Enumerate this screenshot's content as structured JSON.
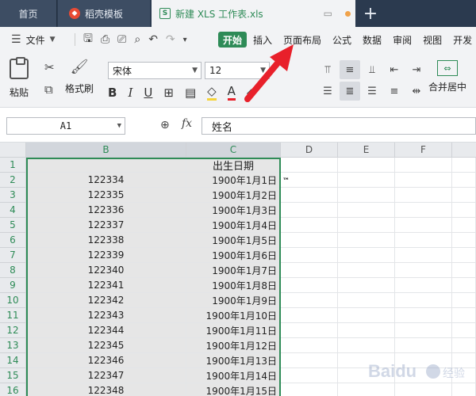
{
  "tabs": {
    "home": "首页",
    "daoke": "稻壳模板",
    "file": "新建 XLS 工作表.xls"
  },
  "menu": {
    "file_label": "文件",
    "start": "开始",
    "items": [
      "插入",
      "页面布局",
      "公式",
      "数据",
      "审阅",
      "视图",
      "开发"
    ]
  },
  "ribbon": {
    "paste": "粘贴",
    "format_painter": "格式刷",
    "font_name": "宋体",
    "font_size": "12",
    "merge_center": "合并居中"
  },
  "formula_bar": {
    "cell_ref": "A1",
    "fx": "fx",
    "content": "姓名"
  },
  "sheet": {
    "columns": [
      "B",
      "C",
      "D",
      "E",
      "F"
    ],
    "header_row_c": "出生日期",
    "rows": [
      {
        "n": "1",
        "b": "",
        "c": "出生日期"
      },
      {
        "n": "2",
        "b": "122334",
        "c": "1900年1月1日"
      },
      {
        "n": "3",
        "b": "122335",
        "c": "1900年1月2日"
      },
      {
        "n": "4",
        "b": "122336",
        "c": "1900年1月3日"
      },
      {
        "n": "5",
        "b": "122337",
        "c": "1900年1月4日"
      },
      {
        "n": "6",
        "b": "122338",
        "c": "1900年1月5日"
      },
      {
        "n": "7",
        "b": "122339",
        "c": "1900年1月6日"
      },
      {
        "n": "8",
        "b": "122340",
        "c": "1900年1月7日"
      },
      {
        "n": "9",
        "b": "122341",
        "c": "1900年1月8日"
      },
      {
        "n": "10",
        "b": "122342",
        "c": "1900年1月9日"
      },
      {
        "n": "11",
        "b": "122343",
        "c": "1900年1月10日"
      },
      {
        "n": "12",
        "b": "122344",
        "c": "1900年1月11日"
      },
      {
        "n": "13",
        "b": "122345",
        "c": "1900年1月12日"
      },
      {
        "n": "14",
        "b": "122346",
        "c": "1900年1月13日"
      },
      {
        "n": "15",
        "b": "122347",
        "c": "1900年1月14日"
      },
      {
        "n": "16",
        "b": "122348",
        "c": "1900年1月15日"
      }
    ],
    "tm": "™"
  },
  "colors": {
    "accent": "#2e8b57",
    "arrow": "#e8202a",
    "tabbar": "#2b3a4f"
  }
}
